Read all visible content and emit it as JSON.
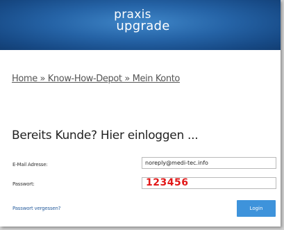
{
  "header": {
    "logo_line1": "praxis",
    "logo_line2": "upgrade"
  },
  "breadcrumb": "Home » Know-How-Depot » Mein Konto",
  "login": {
    "title": "Bereits Kunde? Hier einloggen ...",
    "email_label": "E-Mail Adresse:",
    "email_value": "noreply@medi-tec.info",
    "password_label": "Passwort:",
    "password_value": "123456",
    "forgot_link": "Passwort vergessen?",
    "login_button": "Login"
  },
  "colors": {
    "header_blue": "#2563a6",
    "button_blue": "#3e93db",
    "password_text": "#e21818"
  }
}
